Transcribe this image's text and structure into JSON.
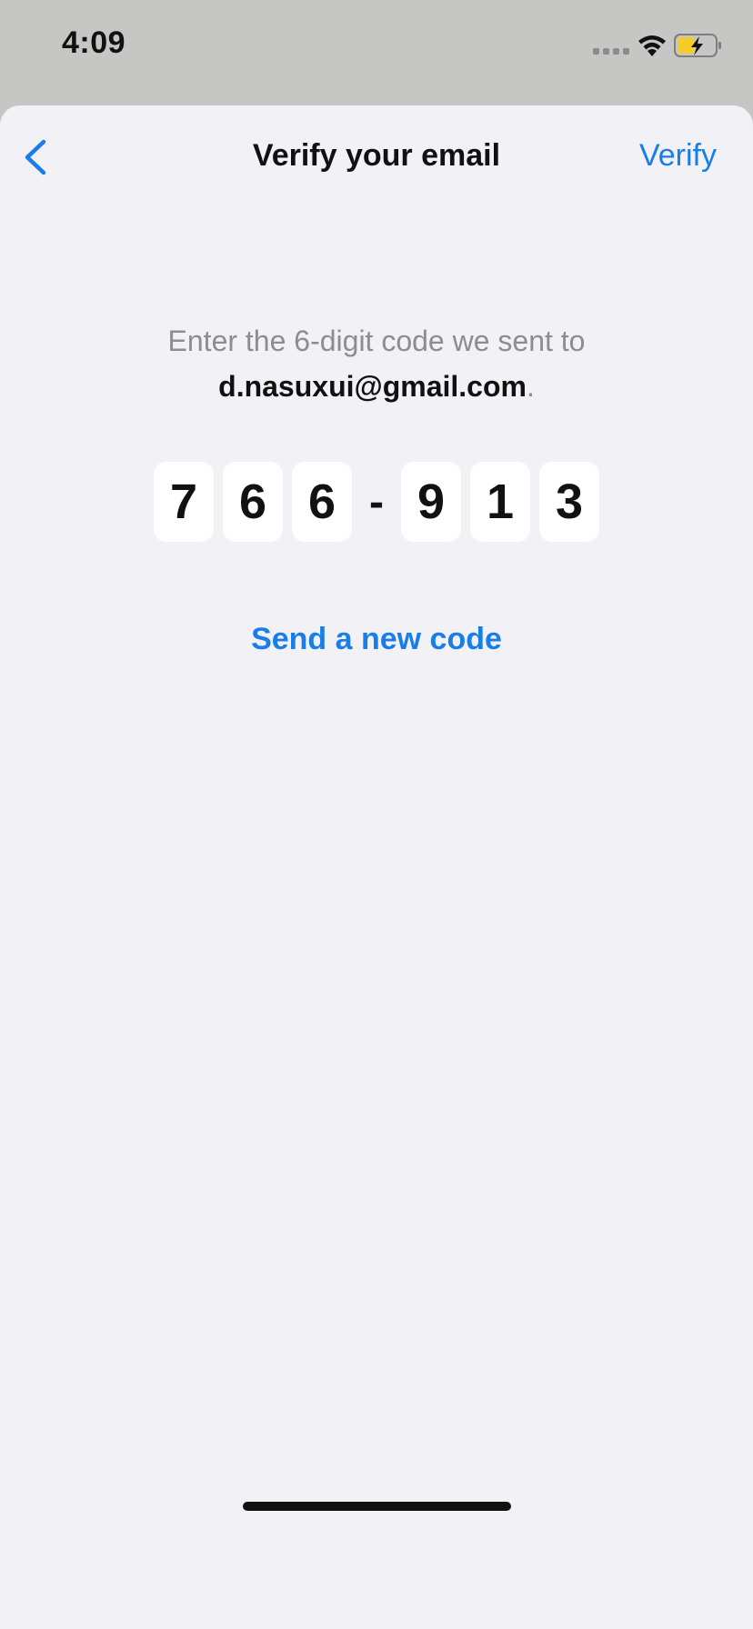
{
  "status_bar": {
    "time": "4:09",
    "icons": [
      "cellular-signal-icon",
      "wifi-icon",
      "battery-charging-icon"
    ]
  },
  "nav": {
    "back_icon": "chevron-left-icon",
    "title": "Verify your email",
    "action_label": "Verify"
  },
  "instruction": {
    "line1": "Enter the 6-digit code we sent to",
    "email": "d.nasuxui@gmail.com",
    "suffix": "."
  },
  "code": {
    "digits": [
      "7",
      "6",
      "6",
      "9",
      "1",
      "3"
    ],
    "separator": "-"
  },
  "resend_label": "Send a new code",
  "colors": {
    "accent": "#1a7ee8",
    "background": "#f1f1f6",
    "text": "#111111",
    "secondary_text": "#8c8c91",
    "battery_fill": "#f4cd2a"
  }
}
